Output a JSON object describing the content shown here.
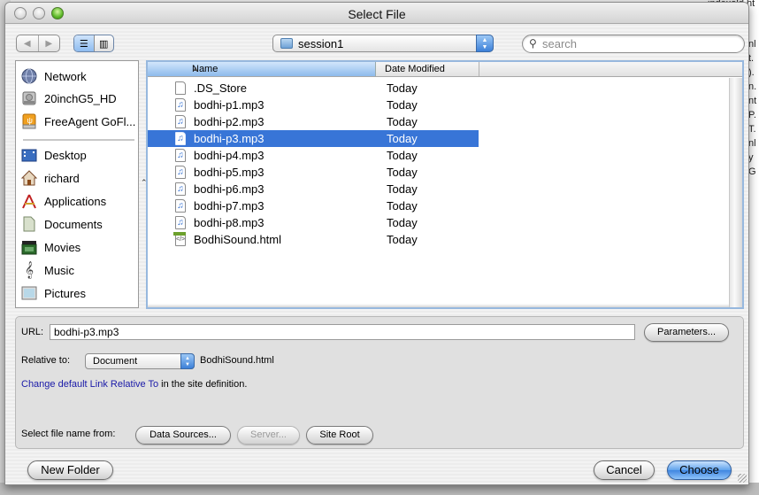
{
  "window": {
    "title": "Select File"
  },
  "background_fragments": [
    "indexold.ht",
    "nl",
    "t.",
    ").",
    "n.",
    "nt",
    "P.",
    "T.",
    "nl",
    "y",
    "G"
  ],
  "toolbar": {
    "back_icon": "back-arrow-icon",
    "forward_icon": "forward-arrow-icon",
    "list_view_icon": "list-view-icon",
    "column_view_icon": "column-view-icon",
    "location": "session1",
    "search_placeholder": "search"
  },
  "sidebar": {
    "devices": [
      {
        "label": "Network",
        "icon": "network-globe-icon"
      },
      {
        "label": "20inchG5_HD",
        "icon": "hard-drive-icon"
      },
      {
        "label": "FreeAgent GoFl...",
        "icon": "usb-drive-icon"
      }
    ],
    "places": [
      {
        "label": "Desktop",
        "icon": "desktop-icon"
      },
      {
        "label": "richard",
        "icon": "home-icon"
      },
      {
        "label": "Applications",
        "icon": "applications-icon"
      },
      {
        "label": "Documents",
        "icon": "documents-icon"
      },
      {
        "label": "Movies",
        "icon": "movies-icon"
      },
      {
        "label": "Music",
        "icon": "music-icon"
      },
      {
        "label": "Pictures",
        "icon": "pictures-icon"
      }
    ]
  },
  "file_list": {
    "columns": {
      "name": "Name",
      "date": "Date Modified"
    },
    "sort_indicator": "▲",
    "rows": [
      {
        "name": ".DS_Store",
        "date": "Today",
        "type": "generic"
      },
      {
        "name": "bodhi-p1.mp3",
        "date": "Today",
        "type": "audio"
      },
      {
        "name": "bodhi-p2.mp3",
        "date": "Today",
        "type": "audio"
      },
      {
        "name": "bodhi-p3.mp3",
        "date": "Today",
        "type": "audio",
        "selected": true
      },
      {
        "name": "bodhi-p4.mp3",
        "date": "Today",
        "type": "audio"
      },
      {
        "name": "bodhi-p5.mp3",
        "date": "Today",
        "type": "audio"
      },
      {
        "name": "bodhi-p6.mp3",
        "date": "Today",
        "type": "audio"
      },
      {
        "name": "bodhi-p7.mp3",
        "date": "Today",
        "type": "audio"
      },
      {
        "name": "bodhi-p8.mp3",
        "date": "Today",
        "type": "audio"
      },
      {
        "name": "BodhiSound.html",
        "date": "Today",
        "type": "html"
      }
    ]
  },
  "options": {
    "url_label": "URL:",
    "url_value": "bodhi-p3.mp3",
    "parameters_button": "Parameters...",
    "relative_label": "Relative to:",
    "relative_value": "Document",
    "relative_file": "BodhiSound.html",
    "change_link": "Change default Link Relative To",
    "change_suffix": " in the site definition.",
    "select_from_label": "Select file name from:",
    "data_sources_button": "Data Sources...",
    "server_button": "Server...",
    "site_root_button": "Site Root"
  },
  "footer": {
    "new_folder": "New Folder",
    "cancel": "Cancel",
    "choose": "Choose"
  }
}
